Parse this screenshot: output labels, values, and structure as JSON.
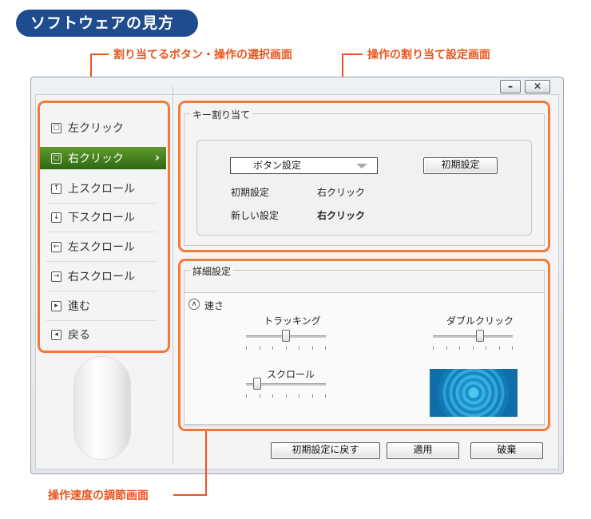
{
  "title_pill": "ソフトウェアの見方",
  "annotations": {
    "button_select": "割り当てるボタン・操作の選択画面",
    "assign_settings": "操作の割り当て設定画面",
    "speed_settings": "操作速度の調節画面"
  },
  "window_controls": {
    "minimize": "–",
    "close": "✕"
  },
  "sidebar": {
    "items": [
      {
        "label": "左クリック",
        "icon": "mouse-left-icon",
        "glyph": "▢"
      },
      {
        "label": "右クリック",
        "icon": "mouse-right-icon",
        "glyph": "▢",
        "active": true
      },
      {
        "label": "上スクロール",
        "icon": "scroll-up-icon",
        "glyph": "↑"
      },
      {
        "label": "下スクロール",
        "icon": "scroll-down-icon",
        "glyph": "↓"
      },
      {
        "label": "左スクロール",
        "icon": "scroll-left-icon",
        "glyph": "←"
      },
      {
        "label": "右スクロール",
        "icon": "scroll-right-icon",
        "glyph": "→"
      },
      {
        "label": "進む",
        "icon": "forward-icon",
        "glyph": "▸"
      },
      {
        "label": "戻る",
        "icon": "back-icon",
        "glyph": "◂"
      }
    ],
    "active_chevron": "›"
  },
  "key_assign": {
    "group_label": "キー割り当て",
    "dropdown_value": "ボタン設定",
    "reset_button": "初期設定",
    "row1_label": "初期設定",
    "row1_value": "右クリック",
    "row2_label": "新しい設定",
    "row2_value": "右クリック"
  },
  "detail": {
    "group_label": "詳細設定",
    "speed_label": "速さ",
    "tracking_label": "トラッキング",
    "doubleclick_label": "ダブルクリック",
    "scroll_label": "スクロール",
    "tracking_level": 0.5,
    "doubleclick_level": 0.6,
    "scroll_level": 0.1
  },
  "footer": {
    "restore_defaults": "初期設定に戻す",
    "apply": "適用",
    "discard": "破棄"
  },
  "colors": {
    "accent_orange": "#e8551f",
    "pill_blue": "#1f4b8f",
    "active_green": "#3f7d1b"
  }
}
